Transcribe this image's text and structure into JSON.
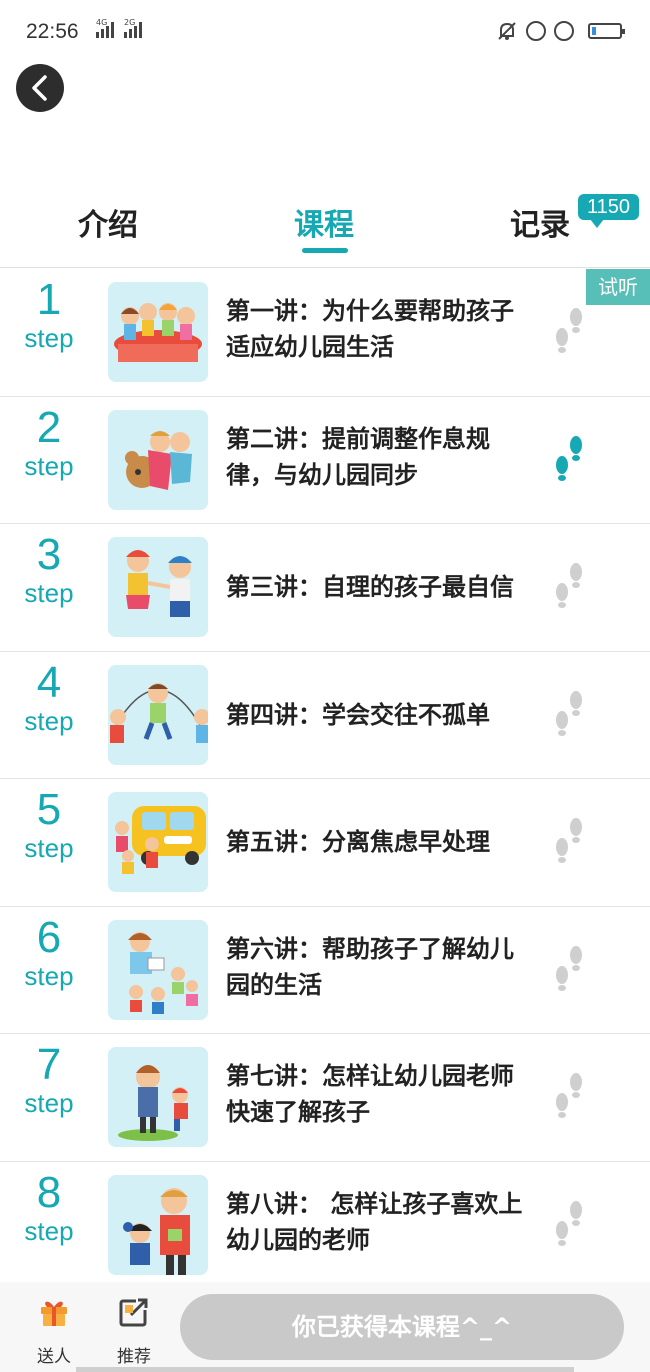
{
  "status_bar": {
    "time": "22:56",
    "network_1": "4G",
    "network_2": "2G"
  },
  "tabs": {
    "intro": "介绍",
    "course": "课程",
    "record": "记录",
    "record_badge": "1150",
    "active": "course"
  },
  "accent_color": "#16a9b4",
  "courses": [
    {
      "step": "1",
      "step_word": "step",
      "title": "第一讲：为什么要帮助孩子适应幼儿园生活",
      "trial": "试听",
      "footprint": "gray"
    },
    {
      "step": "2",
      "step_word": "step",
      "title": "第二讲：提前调整作息规律，与幼儿园同步",
      "footprint": "teal"
    },
    {
      "step": "3",
      "step_word": "step",
      "title": "第三讲：自理的孩子最自信",
      "footprint": "gray"
    },
    {
      "step": "4",
      "step_word": "step",
      "title": "第四讲：学会交往不孤单",
      "footprint": "gray"
    },
    {
      "step": "5",
      "step_word": "step",
      "title": "第五讲：分离焦虑早处理",
      "footprint": "gray"
    },
    {
      "step": "6",
      "step_word": "step",
      "title": "第六讲：帮助孩子了解幼儿园的生活",
      "footprint": "gray"
    },
    {
      "step": "7",
      "step_word": "step",
      "title": "第七讲：怎样让幼儿园老师快速了解孩子",
      "footprint": "gray"
    },
    {
      "step": "8",
      "step_word": "step",
      "title": "第八讲： 怎样让孩子喜欢上幼儿园的老师",
      "footprint": "gray"
    }
  ],
  "bottom_bar": {
    "gift_label": "送人",
    "share_label": "推荐",
    "cta_label": "你已获得本课程^_^"
  }
}
